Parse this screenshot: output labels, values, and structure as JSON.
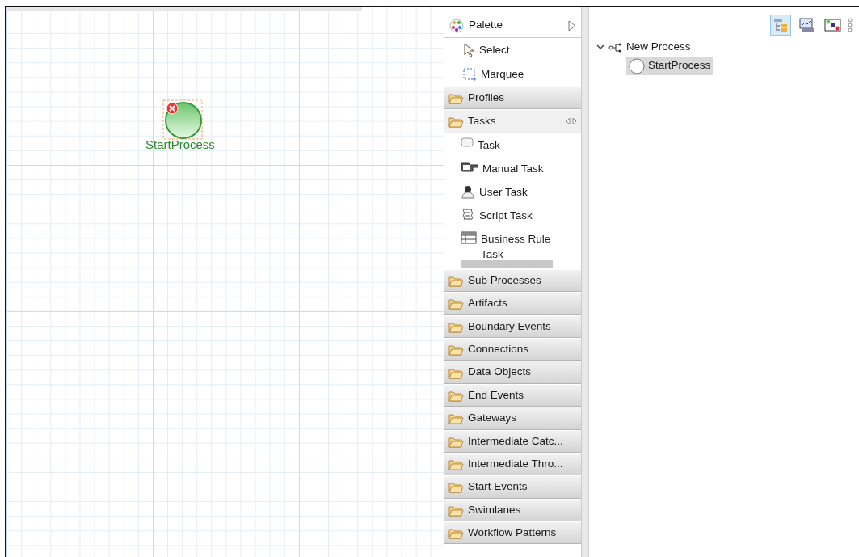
{
  "canvas": {
    "nodes": [
      {
        "kind": "start-event",
        "label": "StartProcess",
        "error": true,
        "selected": true
      }
    ]
  },
  "palette": {
    "title": "Palette",
    "tools": [
      {
        "kind": "select",
        "label": "Select"
      },
      {
        "kind": "marquee",
        "label": "Marquee"
      }
    ],
    "drawers": [
      {
        "label": "Profiles",
        "expanded": false
      },
      {
        "label": "Tasks",
        "expanded": true,
        "pinned": true,
        "items": [
          {
            "kind": "task",
            "label": "Task"
          },
          {
            "kind": "manual",
            "label": "Manual Task"
          },
          {
            "kind": "user",
            "label": "User Task"
          },
          {
            "kind": "script",
            "label": "Script Task"
          },
          {
            "kind": "rule",
            "label": "Business Rule Task"
          }
        ]
      },
      {
        "label": "Sub Processes",
        "expanded": false
      },
      {
        "label": "Artifacts",
        "expanded": false
      },
      {
        "label": "Boundary Events",
        "expanded": false
      },
      {
        "label": "Connections",
        "expanded": false
      },
      {
        "label": "Data Objects",
        "expanded": false
      },
      {
        "label": "End Events",
        "expanded": false
      },
      {
        "label": "Gateways",
        "expanded": false
      },
      {
        "label": "Intermediate Catc...",
        "expanded": false
      },
      {
        "label": "Intermediate Thro...",
        "expanded": false
      },
      {
        "label": "Start Events",
        "expanded": false
      },
      {
        "label": "Swimlanes",
        "expanded": false
      },
      {
        "label": "Workflow Patterns",
        "expanded": false
      }
    ]
  },
  "outline": {
    "toolbar": [
      {
        "kind": "tree",
        "selected": true
      },
      {
        "kind": "overview",
        "selected": false
      },
      {
        "kind": "diagram",
        "selected": false
      }
    ],
    "tree": [
      {
        "label": "New Process",
        "kind": "process",
        "expanded": true,
        "selected": false,
        "children": [
          {
            "label": "StartProcess",
            "kind": "start-event",
            "selected": true
          }
        ]
      }
    ]
  }
}
